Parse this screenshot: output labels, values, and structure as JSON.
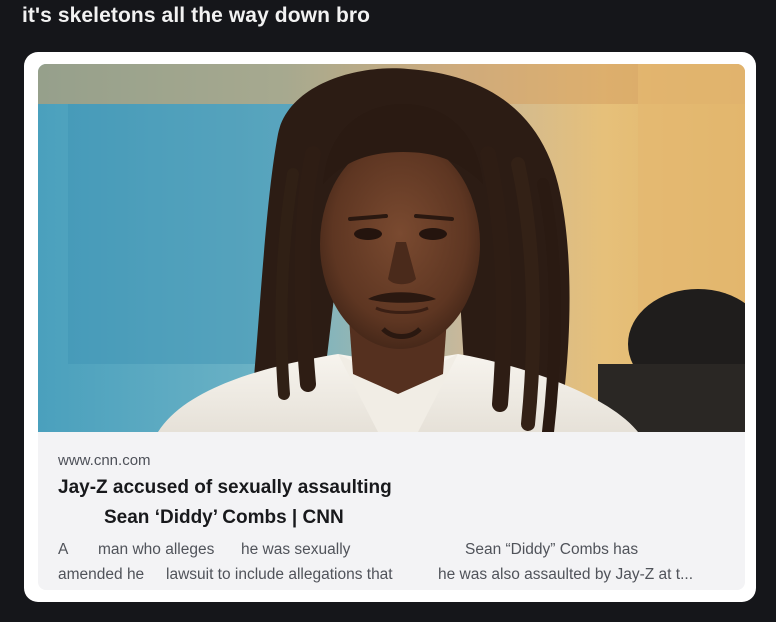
{
  "post": {
    "text": "it's skeletons all the way down bro"
  },
  "link_card": {
    "url": "www.cnn.com",
    "title_line1": "Jay-Z accused of sexually assaulting",
    "title_line2": "Sean ‘Diddy’ Combs | CNN",
    "desc_fragments": [
      "A",
      "man who alleges",
      "he was sexually",
      "Sean “Diddy” Combs has",
      "amended he",
      "lawsuit to include allegations that",
      "he was also assaulted by Jay-Z at t..."
    ]
  },
  "colors": {
    "background": "#15161a",
    "card": "#ffffff",
    "meta_panel": "#f3f3f5"
  }
}
